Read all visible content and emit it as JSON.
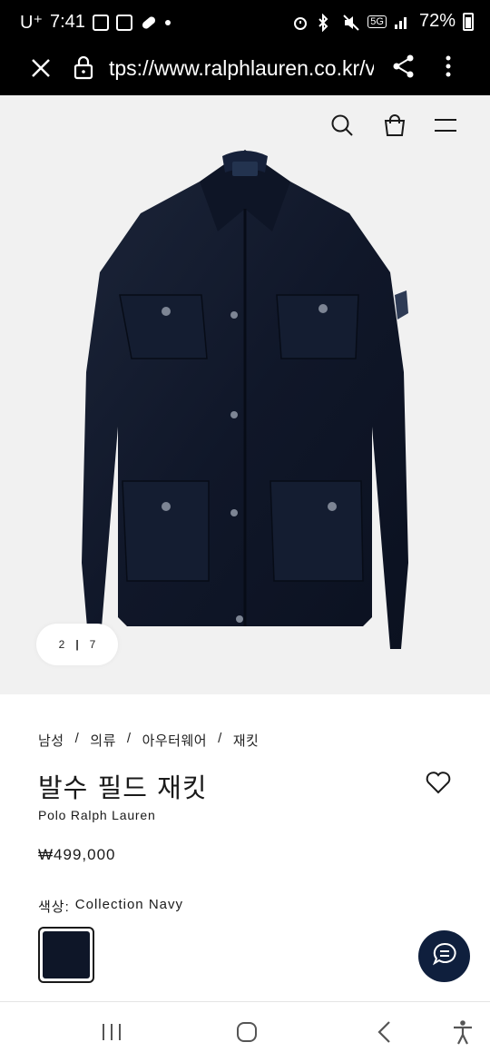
{
  "status_bar": {
    "carrier": "U⁺",
    "time": "7:41",
    "network": "5G",
    "battery": "72%"
  },
  "browser": {
    "url": "tps://www.ralphlauren.co.kr/v",
    "icons": [
      "close-icon",
      "lock-icon",
      "share-icon",
      "more-icon"
    ]
  },
  "site_header": {
    "icons": [
      "search-icon",
      "bag-icon",
      "menu-icon"
    ]
  },
  "gallery": {
    "current": "2",
    "separator": "|",
    "total": "7"
  },
  "product": {
    "breadcrumb": [
      "남성",
      "의류",
      "아우터웨어",
      "재킷"
    ],
    "breadcrumb_sep": "/",
    "title": "발수 필드 재킷",
    "brand": "Polo Ralph Lauren",
    "price": "₩499,000",
    "color_label": "색상:",
    "color_value": "Collection Navy",
    "swatch_color": "#0e1628"
  },
  "chat": {
    "icon": "chat-icon",
    "color": "#0f1f3d"
  },
  "nav_bar": {
    "icons": [
      "recent-apps-icon",
      "home-icon",
      "back-icon",
      "accessibility-icon"
    ]
  }
}
